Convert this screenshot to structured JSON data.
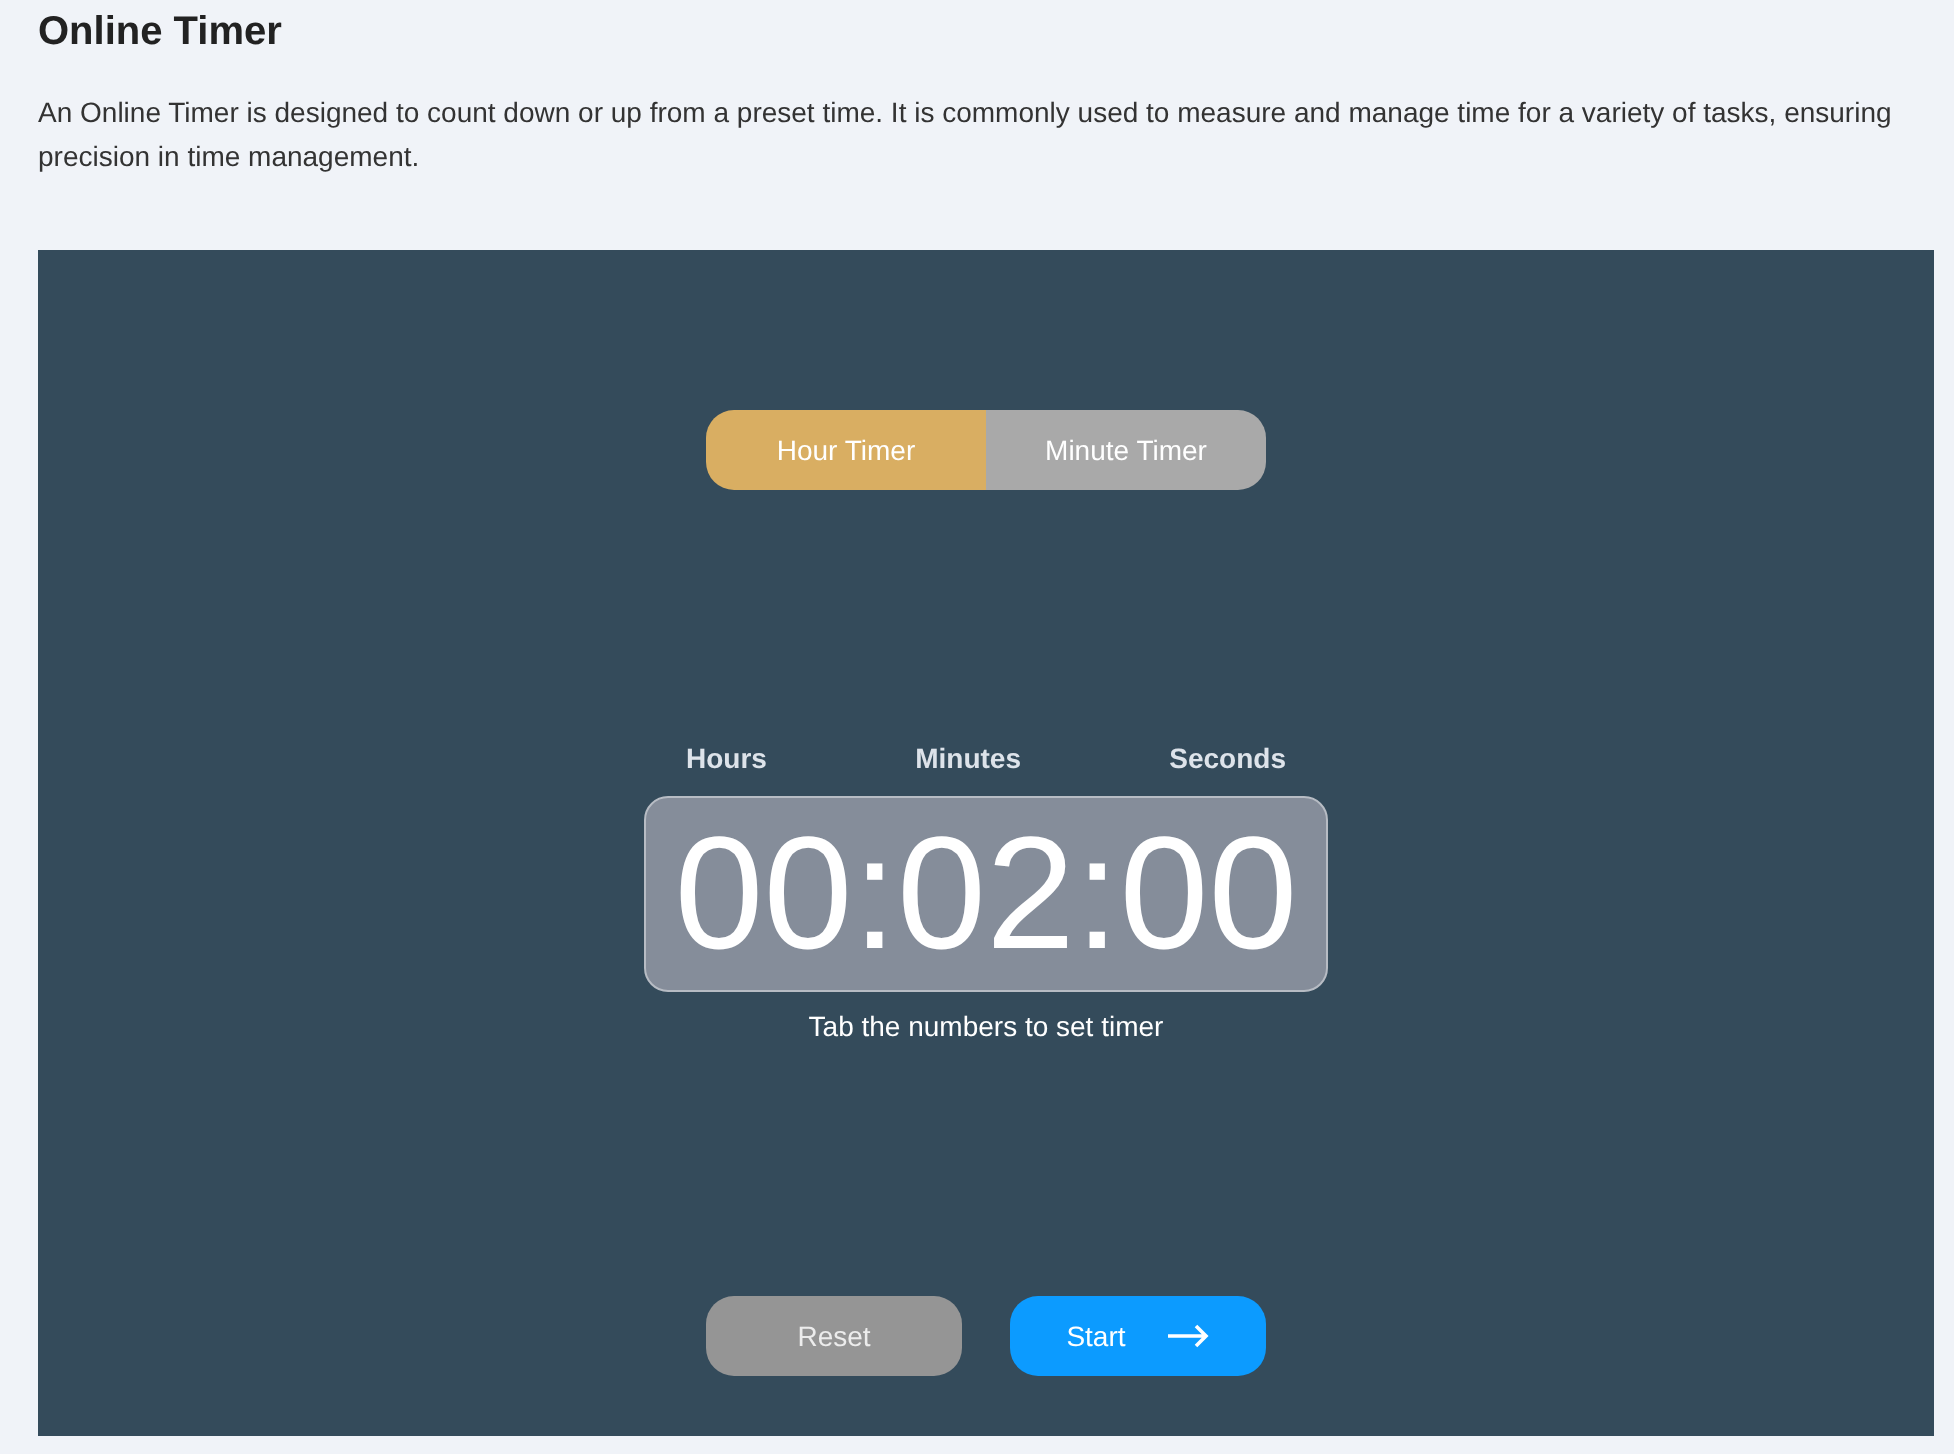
{
  "title": "Online Timer",
  "description": "An Online Timer is designed to count down or up from a preset time. It is commonly used to measure and manage time for a variety of tasks, ensuring precision in time management.",
  "tabs": [
    {
      "label": "Hour Timer",
      "selected": true
    },
    {
      "label": "Minute Timer",
      "selected": false
    }
  ],
  "units": [
    "Hours",
    "Minutes",
    "Seconds"
  ],
  "time": "00:02:00",
  "hint": "Tab the numbers to set timer",
  "buttons": [
    {
      "label": "Reset",
      "kind": "reset",
      "disabled": true
    },
    {
      "label": "Start",
      "kind": "start",
      "disabled": false
    }
  ]
}
